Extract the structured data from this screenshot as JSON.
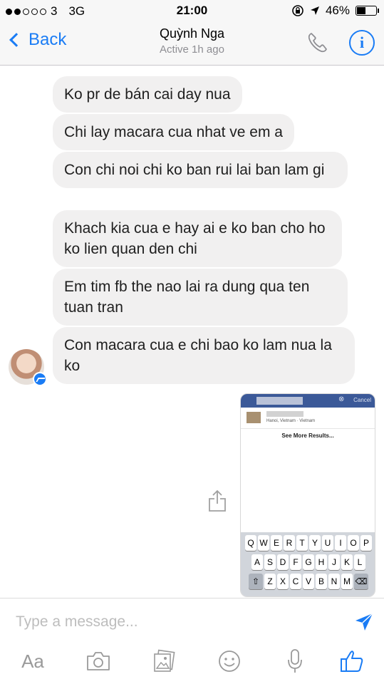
{
  "status_bar": {
    "carrier": "3",
    "network": "3G",
    "time": "21:00",
    "battery": "46%",
    "battery_level": 0.46
  },
  "nav": {
    "back_label": "Back",
    "contact_name": "Quỳnh Nga",
    "active_status": "Active 1h ago"
  },
  "messages": [
    {
      "text": "Ko pr de bán cai day nua"
    },
    {
      "text": "Chi lay macara cua nhat ve em a"
    },
    {
      "text": "Con chi noi chi ko ban rui lai ban lam gi"
    },
    {
      "text": "Khach kia cua e hay ai e ko ban cho ho ko lien quan den chi"
    },
    {
      "text": "Em tim fb the nao lai ra dung qua ten tuan tran"
    },
    {
      "text": "Con macara cua e chi bao ko lam nua la ko"
    }
  ],
  "attachment": {
    "cancel": "Cancel",
    "location": "Hanoi, Vietnam · Vietnam",
    "see_more": "See More Results...",
    "keyboard_rows": [
      [
        "Q",
        "W",
        "E",
        "R",
        "T",
        "Y",
        "U",
        "I",
        "O",
        "P"
      ],
      [
        "A",
        "S",
        "D",
        "F",
        "G",
        "H",
        "J",
        "K",
        "L"
      ],
      [
        "Z",
        "X",
        "C",
        "V",
        "B",
        "N",
        "M"
      ]
    ]
  },
  "composer": {
    "placeholder": "Type a message...",
    "text_format_label": "Aa"
  },
  "colors": {
    "accent": "#1a7cf5",
    "bubble": "#f1f0f0",
    "facebook_blue": "#3b5998"
  },
  "icons": {
    "call": "phone-icon",
    "info": "info-icon",
    "share": "share-icon",
    "send": "send-icon",
    "camera": "camera-icon",
    "gallery": "gallery-icon",
    "emoji": "emoji-icon",
    "mic": "microphone-icon",
    "like": "thumbs-up-icon"
  }
}
